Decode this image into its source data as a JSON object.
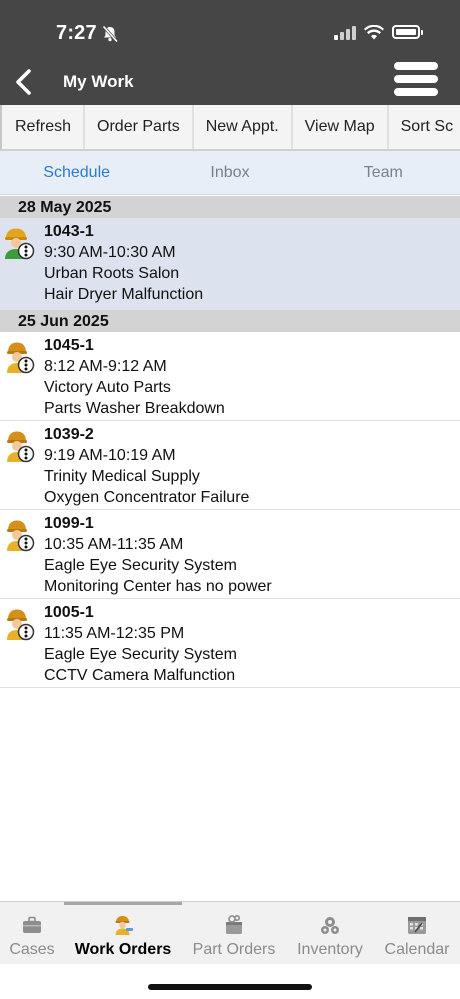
{
  "status": {
    "time": "7:27"
  },
  "nav": {
    "title": "My Work"
  },
  "toolbar": {
    "buttons": [
      "Refresh",
      "Order Parts",
      "New Appt.",
      "View Map",
      "Sort Sc"
    ]
  },
  "tabs": [
    "Schedule",
    "Inbox",
    "Team"
  ],
  "groups": [
    {
      "date": "28 May 2025",
      "items": [
        {
          "number": "1043-1",
          "time": "9:30 AM-10:30 AM",
          "customer": "Urban Roots Salon",
          "issue": "Hair Dryer Malfunction",
          "icon": "technician-complete-icon"
        }
      ]
    },
    {
      "date": "25 Jun 2025",
      "items": [
        {
          "number": "1045-1",
          "time": "8:12 AM-9:12 AM",
          "customer": "Victory Auto Parts",
          "issue": "Parts Washer Breakdown",
          "icon": "technician-info-icon"
        },
        {
          "number": "1039-2",
          "time": "9:19 AM-10:19 AM",
          "customer": "Trinity Medical Supply",
          "issue": "Oxygen Concentrator Failure",
          "icon": "technician-info-icon"
        },
        {
          "number": "1099-1",
          "time": "10:35 AM-11:35 AM",
          "customer": "Eagle Eye Security System",
          "issue": "Monitoring Center has no power",
          "icon": "technician-info-icon"
        },
        {
          "number": "1005-1",
          "time": "11:35 AM-12:35 PM",
          "customer": "Eagle Eye Security System",
          "issue": "CCTV Camera Malfunction",
          "icon": "technician-info-icon"
        }
      ]
    }
  ],
  "bottom_tabs": [
    "Cases",
    "Work Orders",
    "Part Orders",
    "Inventory",
    "Calendar"
  ],
  "colors": {
    "header": "#464646",
    "accent": "#2a7bd0",
    "selected_row": "#dde3ee",
    "date_header": "#d3d3d3"
  }
}
